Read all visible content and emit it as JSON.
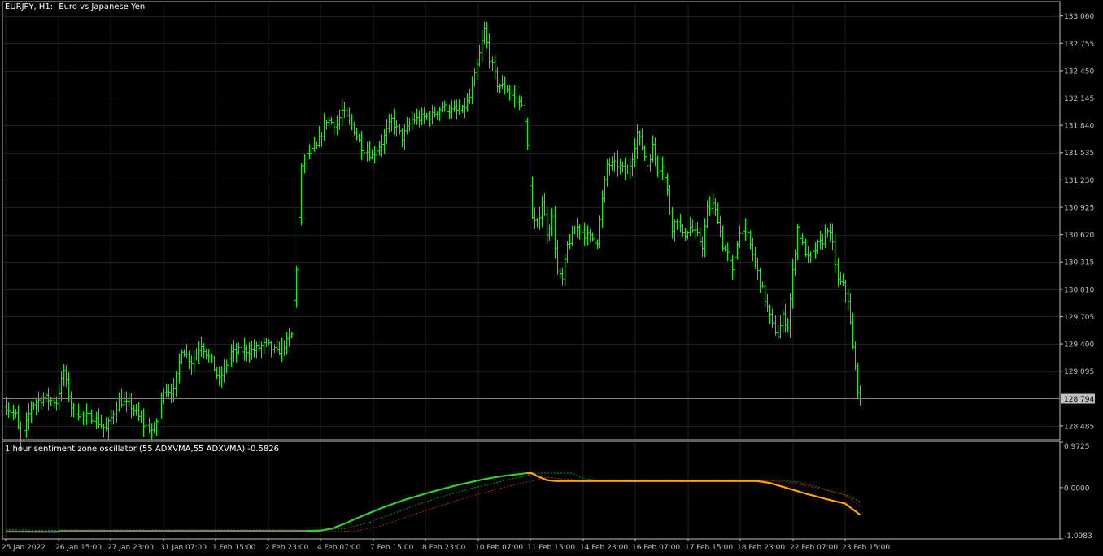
{
  "chart_header": {
    "symbol_timeframe": "EURJPY, H1:",
    "description": "Euro vs Japanese Yen"
  },
  "indicator_header": {
    "label": "1 hour sentiment zone oscillator (55 ADXVMA,55 ADXVMA) -0.5826"
  },
  "colors": {
    "background": "#000000",
    "bars": "#00ff00",
    "axis": "#c0c0c0",
    "grid": "#1e1e1e",
    "price_line": "#808080",
    "price_tag_bg": "#c0c0c0",
    "osc_bull": "#32cd32",
    "osc_bear": "#ffa500",
    "osc_flat": "#808080",
    "osc_level_up": "#00a000",
    "osc_level_dn": "#b22222"
  },
  "chart_data": [
    {
      "type": "ohlc",
      "symbol": "EURJPY",
      "timeframe": "H1",
      "title": "Euro vs Japanese Yen",
      "ylim": [
        128.33,
        133.22
      ],
      "y_ticks": [
        "133.060",
        "132.755",
        "132.450",
        "132.145",
        "131.840",
        "131.535",
        "131.230",
        "130.925",
        "130.620",
        "130.315",
        "130.010",
        "129.705",
        "129.400",
        "129.095",
        "128.485"
      ],
      "current_price": "128.794",
      "x_labels": [
        "25 Jan 2022",
        "26 Jan 15:00",
        "27 Jan 23:00",
        "31 Jan 07:00",
        "1 Feb 15:00",
        "2 Feb 23:00",
        "4 Feb 07:00",
        "7 Feb 15:00",
        "8 Feb 23:00",
        "10 Feb 07:00",
        "11 Feb 15:00",
        "14 Feb 23:00",
        "16 Feb 07:00",
        "17 Feb 15:00",
        "18 Feb 23:00",
        "22 Feb 07:00",
        "23 Feb 15:00"
      ],
      "close_anchors": [
        [
          0,
          128.7
        ],
        [
          4,
          128.6
        ],
        [
          6,
          128.3
        ],
        [
          10,
          128.72
        ],
        [
          15,
          128.8
        ],
        [
          20,
          128.75
        ],
        [
          23,
          129.1
        ],
        [
          26,
          128.7
        ],
        [
          30,
          128.6
        ],
        [
          35,
          128.58
        ],
        [
          40,
          128.44
        ],
        [
          45,
          128.77
        ],
        [
          50,
          128.7
        ],
        [
          55,
          128.5
        ],
        [
          59,
          128.42
        ],
        [
          63,
          128.9
        ],
        [
          67,
          128.87
        ],
        [
          70,
          129.35
        ],
        [
          74,
          129.2
        ],
        [
          78,
          129.4
        ],
        [
          82,
          129.2
        ],
        [
          85,
          128.99
        ],
        [
          90,
          129.3
        ],
        [
          95,
          129.33
        ],
        [
          99,
          129.33
        ],
        [
          104,
          129.4
        ],
        [
          108,
          129.3
        ],
        [
          112,
          129.42
        ],
        [
          114,
          129.5
        ],
        [
          116,
          130.25
        ],
        [
          118,
          131.35
        ],
        [
          120,
          131.5
        ],
        [
          124,
          131.6
        ],
        [
          128,
          131.9
        ],
        [
          132,
          131.85
        ],
        [
          134,
          132.0
        ],
        [
          138,
          131.85
        ],
        [
          142,
          131.6
        ],
        [
          146,
          131.5
        ],
        [
          150,
          131.65
        ],
        [
          154,
          131.9
        ],
        [
          158,
          131.7
        ],
        [
          162,
          131.9
        ],
        [
          166,
          131.92
        ],
        [
          170,
          131.95
        ],
        [
          174,
          132.05
        ],
        [
          178,
          132.0
        ],
        [
          182,
          132.0
        ],
        [
          185,
          132.15
        ],
        [
          188,
          132.5
        ],
        [
          191,
          132.9
        ],
        [
          193,
          132.6
        ],
        [
          196,
          132.3
        ],
        [
          200,
          132.25
        ],
        [
          204,
          132.1
        ],
        [
          206,
          132.1
        ],
        [
          208,
          131.6
        ],
        [
          210,
          130.8
        ],
        [
          212,
          130.7
        ],
        [
          214,
          131.0
        ],
        [
          216,
          130.65
        ],
        [
          218,
          130.8
        ],
        [
          220,
          130.2
        ],
        [
          222,
          130.1
        ],
        [
          224,
          130.5
        ],
        [
          226,
          130.6
        ],
        [
          228,
          130.7
        ],
        [
          232,
          130.6
        ],
        [
          236,
          130.55
        ],
        [
          238,
          131.0
        ],
        [
          240,
          131.4
        ],
        [
          244,
          131.4
        ],
        [
          248,
          131.3
        ],
        [
          250,
          131.5
        ],
        [
          252,
          131.75
        ],
        [
          254,
          131.6
        ],
        [
          256,
          131.4
        ],
        [
          258,
          131.6
        ],
        [
          260,
          131.35
        ],
        [
          262,
          131.4
        ],
        [
          264,
          131.1
        ],
        [
          266,
          130.7
        ],
        [
          268,
          130.8
        ],
        [
          270,
          130.6
        ],
        [
          273,
          130.7
        ],
        [
          276,
          130.6
        ],
        [
          278,
          130.5
        ],
        [
          280,
          130.9
        ],
        [
          282,
          130.95
        ],
        [
          284,
          130.8
        ],
        [
          286,
          130.5
        ],
        [
          288,
          130.4
        ],
        [
          290,
          130.2
        ],
        [
          292,
          130.55
        ],
        [
          294,
          130.7
        ],
        [
          296,
          130.6
        ],
        [
          298,
          130.4
        ],
        [
          300,
          130.2
        ],
        [
          302,
          130.0
        ],
        [
          304,
          129.8
        ],
        [
          306,
          129.6
        ],
        [
          308,
          129.5
        ],
        [
          310,
          129.7
        ],
        [
          312,
          129.6
        ],
        [
          314,
          130.2
        ],
        [
          316,
          130.7
        ],
        [
          318,
          130.5
        ],
        [
          320,
          130.35
        ],
        [
          322,
          130.4
        ],
        [
          324,
          130.5
        ],
        [
          326,
          130.55
        ],
        [
          328,
          130.7
        ],
        [
          330,
          130.5
        ],
        [
          332,
          130.1
        ],
        [
          334,
          130.05
        ],
        [
          336,
          129.9
        ],
        [
          338,
          129.35
        ],
        [
          340,
          128.9
        ],
        [
          341,
          128.794
        ]
      ]
    },
    {
      "type": "line",
      "title": "1 hour sentiment zone oscillator (55 ADXVMA,55 ADXVMA) -0.5826",
      "ylim": [
        -1.1,
        0.99
      ],
      "y_ticks": [
        "0.9725",
        "0.0000",
        "-1.0983"
      ],
      "main_anchors": [
        [
          0,
          -0.94
        ],
        [
          20,
          -0.95
        ],
        [
          22,
          -0.93
        ],
        [
          60,
          -0.93
        ],
        [
          120,
          -0.93
        ],
        [
          126,
          -0.92
        ],
        [
          130,
          -0.88
        ],
        [
          135,
          -0.78
        ],
        [
          140,
          -0.66
        ],
        [
          145,
          -0.55
        ],
        [
          150,
          -0.44
        ],
        [
          155,
          -0.34
        ],
        [
          160,
          -0.25
        ],
        [
          165,
          -0.17
        ],
        [
          170,
          -0.09
        ],
        [
          175,
          -0.02
        ],
        [
          180,
          0.05
        ],
        [
          185,
          0.11
        ],
        [
          190,
          0.17
        ],
        [
          195,
          0.22
        ],
        [
          200,
          0.26
        ],
        [
          205,
          0.29
        ],
        [
          208,
          0.31
        ],
        [
          210,
          0.31
        ],
        [
          212,
          0.25
        ],
        [
          216,
          0.16
        ],
        [
          220,
          0.14
        ],
        [
          230,
          0.14
        ],
        [
          300,
          0.14
        ],
        [
          305,
          0.1
        ],
        [
          310,
          0.02
        ],
        [
          315,
          -0.06
        ],
        [
          320,
          -0.14
        ],
        [
          325,
          -0.21
        ],
        [
          330,
          -0.28
        ],
        [
          335,
          -0.34
        ],
        [
          341,
          -0.5826
        ]
      ],
      "signal_green_anchors": [
        [
          0,
          -0.9
        ],
        [
          20,
          -0.92
        ],
        [
          22,
          -0.91
        ],
        [
          60,
          -0.91
        ],
        [
          125,
          -0.91
        ],
        [
          135,
          -0.88
        ],
        [
          145,
          -0.75
        ],
        [
          155,
          -0.55
        ],
        [
          165,
          -0.35
        ],
        [
          175,
          -0.18
        ],
        [
          185,
          -0.03
        ],
        [
          195,
          0.1
        ],
        [
          205,
          0.22
        ],
        [
          212,
          0.31
        ],
        [
          226,
          0.31
        ],
        [
          230,
          0.2
        ],
        [
          236,
          0.16
        ],
        [
          310,
          0.16
        ],
        [
          316,
          0.12
        ],
        [
          322,
          0.05
        ],
        [
          328,
          -0.05
        ],
        [
          335,
          -0.15
        ],
        [
          341,
          -0.3
        ]
      ],
      "signal_red_anchors": [
        [
          0,
          -0.96
        ],
        [
          20,
          -0.96
        ],
        [
          22,
          -0.95
        ],
        [
          60,
          -0.95
        ],
        [
          125,
          -0.95
        ],
        [
          140,
          -0.93
        ],
        [
          150,
          -0.82
        ],
        [
          160,
          -0.63
        ],
        [
          170,
          -0.45
        ],
        [
          180,
          -0.28
        ],
        [
          190,
          -0.12
        ],
        [
          200,
          0.02
        ],
        [
          208,
          0.12
        ],
        [
          212,
          0.17
        ],
        [
          216,
          0.22
        ],
        [
          220,
          0.2
        ],
        [
          226,
          0.17
        ],
        [
          236,
          0.15
        ],
        [
          305,
          0.15
        ],
        [
          312,
          0.12
        ],
        [
          320,
          0.04
        ],
        [
          328,
          -0.06
        ],
        [
          335,
          -0.16
        ],
        [
          341,
          -0.4
        ]
      ]
    }
  ]
}
